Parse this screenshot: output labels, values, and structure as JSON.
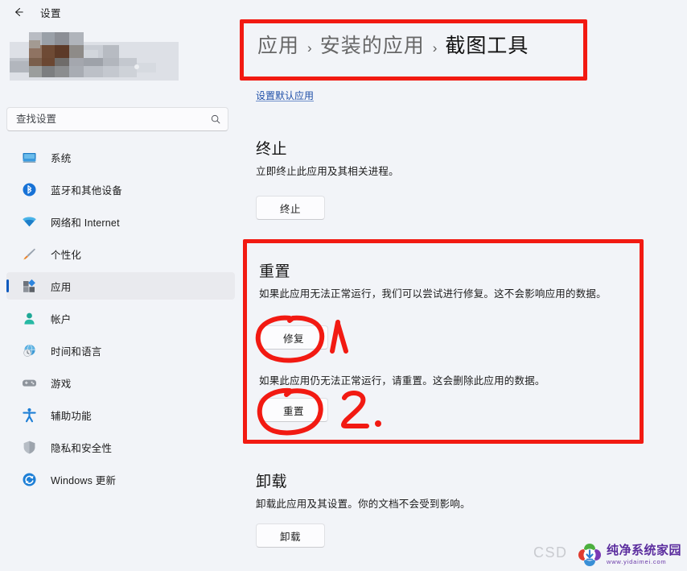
{
  "window": {
    "title": "设置",
    "back_icon": "back-arrow-icon"
  },
  "sidebar": {
    "search": {
      "placeholder": "查找设置",
      "value": "",
      "icon": "search-icon"
    },
    "profile": {
      "censored": true,
      "description": "blurred-account-avatar-and-name"
    },
    "items": [
      {
        "label": "系统",
        "icon": "monitor-icon",
        "selected": false
      },
      {
        "label": "蓝牙和其他设备",
        "icon": "bluetooth-icon",
        "selected": false
      },
      {
        "label": "网络和 Internet",
        "icon": "wifi-icon",
        "selected": false
      },
      {
        "label": "个性化",
        "icon": "paintbrush-icon",
        "selected": false
      },
      {
        "label": "应用",
        "icon": "apps-grid-icon",
        "selected": true
      },
      {
        "label": "帐户",
        "icon": "person-icon",
        "selected": false
      },
      {
        "label": "时间和语言",
        "icon": "globe-clock-icon",
        "selected": false
      },
      {
        "label": "游戏",
        "icon": "gamepad-icon",
        "selected": false
      },
      {
        "label": "辅助功能",
        "icon": "accessibility-icon",
        "selected": false
      },
      {
        "label": "隐私和安全性",
        "icon": "shield-icon",
        "selected": false
      },
      {
        "label": "Windows 更新",
        "icon": "refresh-circle-icon",
        "selected": false
      }
    ]
  },
  "main": {
    "breadcrumb": {
      "items": [
        "应用",
        "安装的应用",
        "截图工具"
      ],
      "separator": "›"
    },
    "default_apps_link": "设置默认应用",
    "sections": [
      {
        "key": "terminate",
        "title": "终止",
        "descriptions": [
          "立即终止此应用及其相关进程。"
        ],
        "button": "终止"
      },
      {
        "key": "reset",
        "title": "重置",
        "descriptions": [
          "如果此应用无法正常运行，我们可以尝试进行修复。这不会影响应用的数据。",
          "如果此应用仍无法正常运行，请重置。这会删除此应用的数据。"
        ],
        "repair_button": "修复",
        "reset_button": "重置"
      },
      {
        "key": "uninstall",
        "title": "卸载",
        "descriptions": [
          "卸载此应用及其设置。你的文档不会受到影响。"
        ],
        "button": "卸载"
      }
    ]
  },
  "annotations": {
    "color": "#F21A12",
    "breadcrumb_box": "red-rectangle-around-breadcrumb",
    "reset_box": "red-rectangle-around-reset-section",
    "repair_circle": "red-circle-around-repair-button",
    "reset_circle": "red-circle-around-reset-button",
    "step_one": "1",
    "step_two": "2."
  },
  "watermarks": {
    "csd": "CSD",
    "site_name": "纯净系统家园",
    "site_url": "www.yidaimei.com",
    "logo_colors": {
      "top": "#4CAF3E",
      "left": "#E03B2F",
      "right": "#7B39B5",
      "bottom": "#3A8FD6",
      "arrow": "#2F7FD0"
    }
  }
}
